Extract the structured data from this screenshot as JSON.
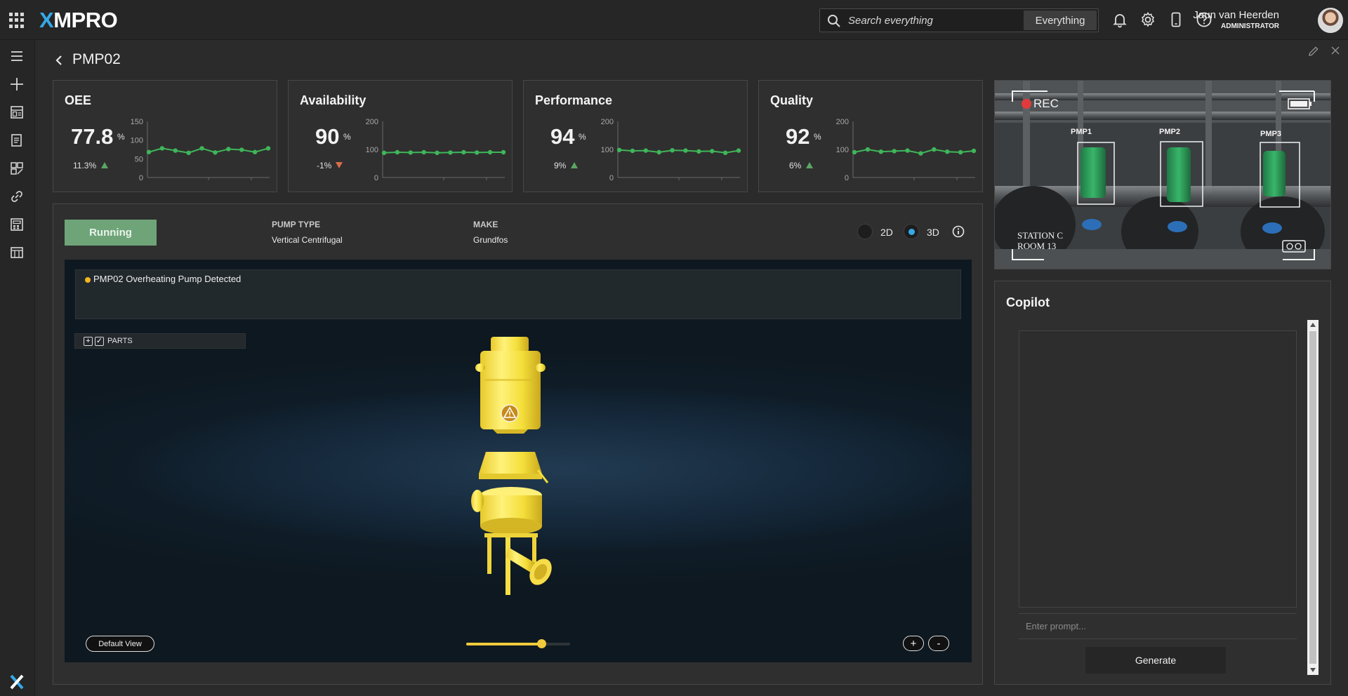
{
  "app": {
    "brand_left": "X",
    "brand_right": "MPRO"
  },
  "search": {
    "placeholder": "Search everything",
    "scope": "Everything"
  },
  "user": {
    "name": "Jaun van Heerden",
    "role": "ADMINISTRATOR"
  },
  "page": {
    "title": "PMP02"
  },
  "kpis": [
    {
      "title": "OEE",
      "value": "77.8",
      "unit": "%",
      "delta": "11.3%",
      "trend": "up",
      "ymax": 150,
      "ticks": [
        "150",
        "100",
        "50",
        "0"
      ],
      "series": [
        68,
        78,
        72,
        66,
        78,
        67,
        76,
        74,
        68,
        78
      ]
    },
    {
      "title": "Availability",
      "value": "90",
      "unit": "%",
      "delta": "-1%",
      "trend": "down",
      "ymax": 200,
      "ticks": [
        "200",
        "100",
        "0"
      ],
      "series": [
        88,
        90,
        89,
        90,
        88,
        89,
        90,
        89,
        90,
        90
      ]
    },
    {
      "title": "Performance",
      "value": "94",
      "unit": "%",
      "delta": "9%",
      "trend": "up",
      "ymax": 200,
      "ticks": [
        "200",
        "100",
        "0"
      ],
      "series": [
        98,
        95,
        96,
        90,
        97,
        96,
        93,
        94,
        88,
        96
      ]
    },
    {
      "title": "Quality",
      "value": "92",
      "unit": "%",
      "delta": "6%",
      "trend": "up",
      "ymax": 200,
      "ticks": [
        "200",
        "100",
        "0"
      ],
      "series": [
        90,
        100,
        92,
        94,
        96,
        86,
        100,
        92,
        90,
        95
      ]
    }
  ],
  "camera": {
    "rec": "REC",
    "location_line1": "STATION C",
    "location_line2": "ROOM 13",
    "pumps": [
      "PMP1",
      "PMP2",
      "PMP3"
    ]
  },
  "main": {
    "status": "Running",
    "pump_type_label": "PUMP TYPE",
    "pump_type": "Vertical Centrifugal",
    "make_label": "MAKE",
    "make": "Grundfos",
    "view_2d": "2D",
    "view_3d": "3D",
    "selected_view": "3D"
  },
  "viewer": {
    "alert": "PMP02 Overheating Pump Detected",
    "parts_label": "PARTS",
    "default_view": "Default View",
    "explode_level": 0.72,
    "zoom_in": "+",
    "zoom_out": "-"
  },
  "copilot": {
    "title": "Copilot",
    "placeholder": "Enter prompt...",
    "generate": "Generate"
  },
  "colors": {
    "accent": "#35a9e8",
    "running": "#6fa478",
    "spark": "#3fb65a",
    "alert": "#f2b620",
    "pump": "#f5dd3a"
  }
}
